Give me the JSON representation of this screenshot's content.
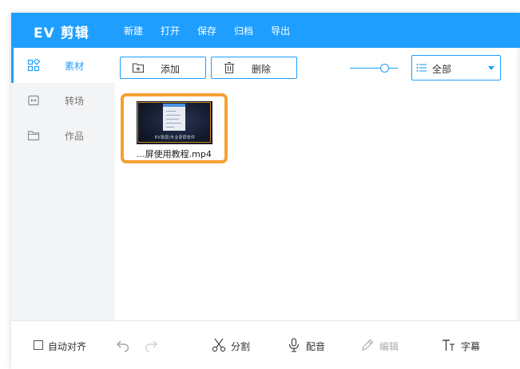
{
  "app": {
    "title": "EV 剪辑",
    "menu": [
      "新建",
      "打开",
      "保存",
      "归档",
      "导出"
    ]
  },
  "sidebar": {
    "items": [
      {
        "label": "素材",
        "icon": "grid-icon",
        "active": true
      },
      {
        "label": "转场",
        "icon": "transition-icon",
        "active": false
      },
      {
        "label": "作品",
        "icon": "folder-icon",
        "active": false
      }
    ]
  },
  "toolbar": {
    "add_label": "添加",
    "delete_label": "删除",
    "filter_selected": "全部"
  },
  "media": [
    {
      "filename": "...屏使用教程.mp4",
      "thumb_caption": "EV录屏|专业录屏软件"
    }
  ],
  "footer": {
    "auto_align_label": "自动对齐",
    "split_label": "分割",
    "dub_label": "配音",
    "edit_label": "编辑",
    "subtitle_label": "字幕"
  },
  "colors": {
    "accent": "#1e9fff",
    "selection": "#f5a033"
  }
}
